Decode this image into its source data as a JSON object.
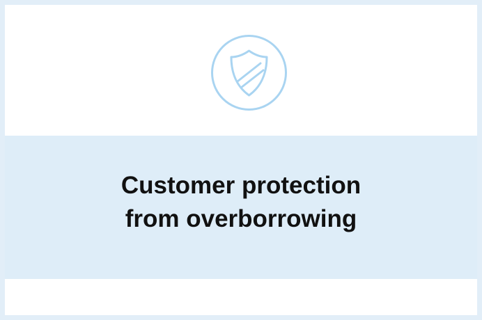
{
  "card": {
    "icon": "shield-icon",
    "accent_color": "#a9d4f1",
    "band_color": "#deedf8",
    "border_color": "#e2eef8",
    "title_line_1": "Customer protection",
    "title_line_2": "from overborrowing"
  }
}
